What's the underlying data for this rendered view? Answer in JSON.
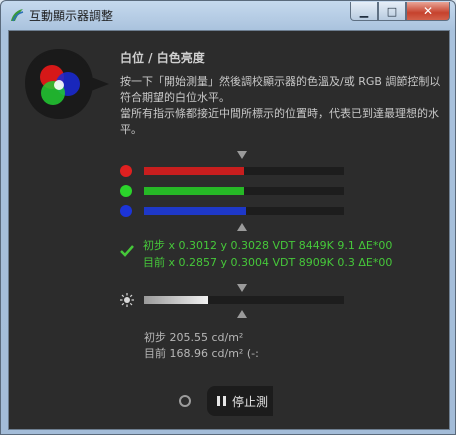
{
  "window": {
    "title": "互動顯示器調整"
  },
  "controls": {
    "minimize": "▁",
    "maximize": "□",
    "close": "✕"
  },
  "section": {
    "heading": "白位 / 白色亮度",
    "description": [
      "按一下「開始測量」然後調校顯示器的色溫及/或 RGB 調節控制以符合期望的白位水平。",
      "當所有指示條都接近中間所標示的位置時，代表已到達最理想的水平。"
    ]
  },
  "rgb_bars": [
    {
      "name": "red",
      "color": "#c81e1e",
      "dot": "#e02020",
      "level": 0.5,
      "top_marker": 0.49,
      "bottom_marker": 0.49
    },
    {
      "name": "green",
      "color": "#26b826",
      "dot": "#2bd42b",
      "level": 0.5,
      "top_marker": 0.49,
      "bottom_marker": 0.49
    },
    {
      "name": "blue",
      "color": "#1e38c8",
      "dot": "#1c34d8",
      "level": 0.51,
      "top_marker": 0.49,
      "bottom_marker": 0.49
    }
  ],
  "results": {
    "initial": "初步 x 0.3012 y 0.3028 VDT 8449K 9.1 ΔE*00",
    "current": "目前 x 0.2857 y 0.3004 VDT 8909K 0.3 ΔE*00",
    "accent": "#46c83a"
  },
  "luminance": {
    "level": 0.32,
    "marker": 0.49,
    "initial": "初步 205.55 cd/m²",
    "current": "目前 168.96 cd/m² (-:"
  },
  "buttons": {
    "stop": "停止測"
  }
}
